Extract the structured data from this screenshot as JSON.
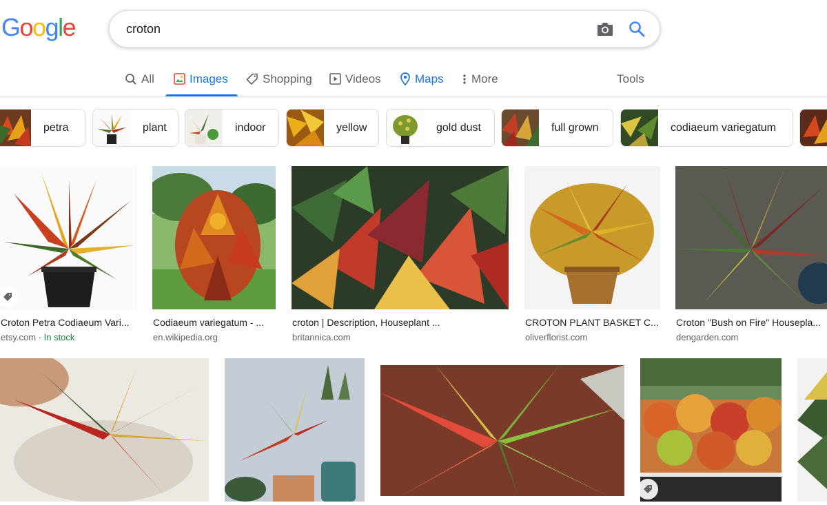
{
  "logo": {
    "letters": [
      "G",
      "o",
      "o",
      "g",
      "l",
      "e"
    ],
    "colors": [
      "#4285F4",
      "#EA4335",
      "#FBBC05",
      "#4285F4",
      "#34A853",
      "#EA4335"
    ]
  },
  "search": {
    "query": "croton",
    "camera_icon": "camera-icon",
    "search_icon": "search-icon"
  },
  "nav": {
    "tabs": [
      {
        "label": "All",
        "icon": "search-icon"
      },
      {
        "label": "Images",
        "icon": "image-icon"
      },
      {
        "label": "Shopping",
        "icon": "tag-icon"
      },
      {
        "label": "Videos",
        "icon": "play-icon"
      },
      {
        "label": "Maps",
        "icon": "map-pin-icon"
      },
      {
        "label": "More",
        "icon": "dots-vertical-icon"
      }
    ],
    "tools": "Tools",
    "active_tab": "Images"
  },
  "chips": [
    {
      "label": "petra"
    },
    {
      "label": "plant"
    },
    {
      "label": "indoor"
    },
    {
      "label": "yellow"
    },
    {
      "label": "gold dust"
    },
    {
      "label": "full grown"
    },
    {
      "label": "codiaeum variegatum"
    }
  ],
  "results_row1": [
    {
      "title": "Croton Petra Codiaeum Vari...",
      "source": "etsy.com",
      "extra": " · In stock",
      "has_tag": true
    },
    {
      "title": "Codiaeum variegatum - ...",
      "source": "en.wikipedia.org",
      "extra": "",
      "has_tag": false
    },
    {
      "title": "croton | Description, Houseplant ...",
      "source": "britannica.com",
      "extra": "",
      "has_tag": false
    },
    {
      "title": "CROTON PLANT BASKET C...",
      "source": "oliverflorist.com",
      "extra": "",
      "has_tag": false
    },
    {
      "title": "Croton \"Bush on Fire\" Housepla...",
      "source": "dengarden.com",
      "extra": "",
      "has_tag": false
    }
  ],
  "colors": {
    "accent": "#1a73e8",
    "stock": "#188038",
    "muted": "#5f6368"
  }
}
